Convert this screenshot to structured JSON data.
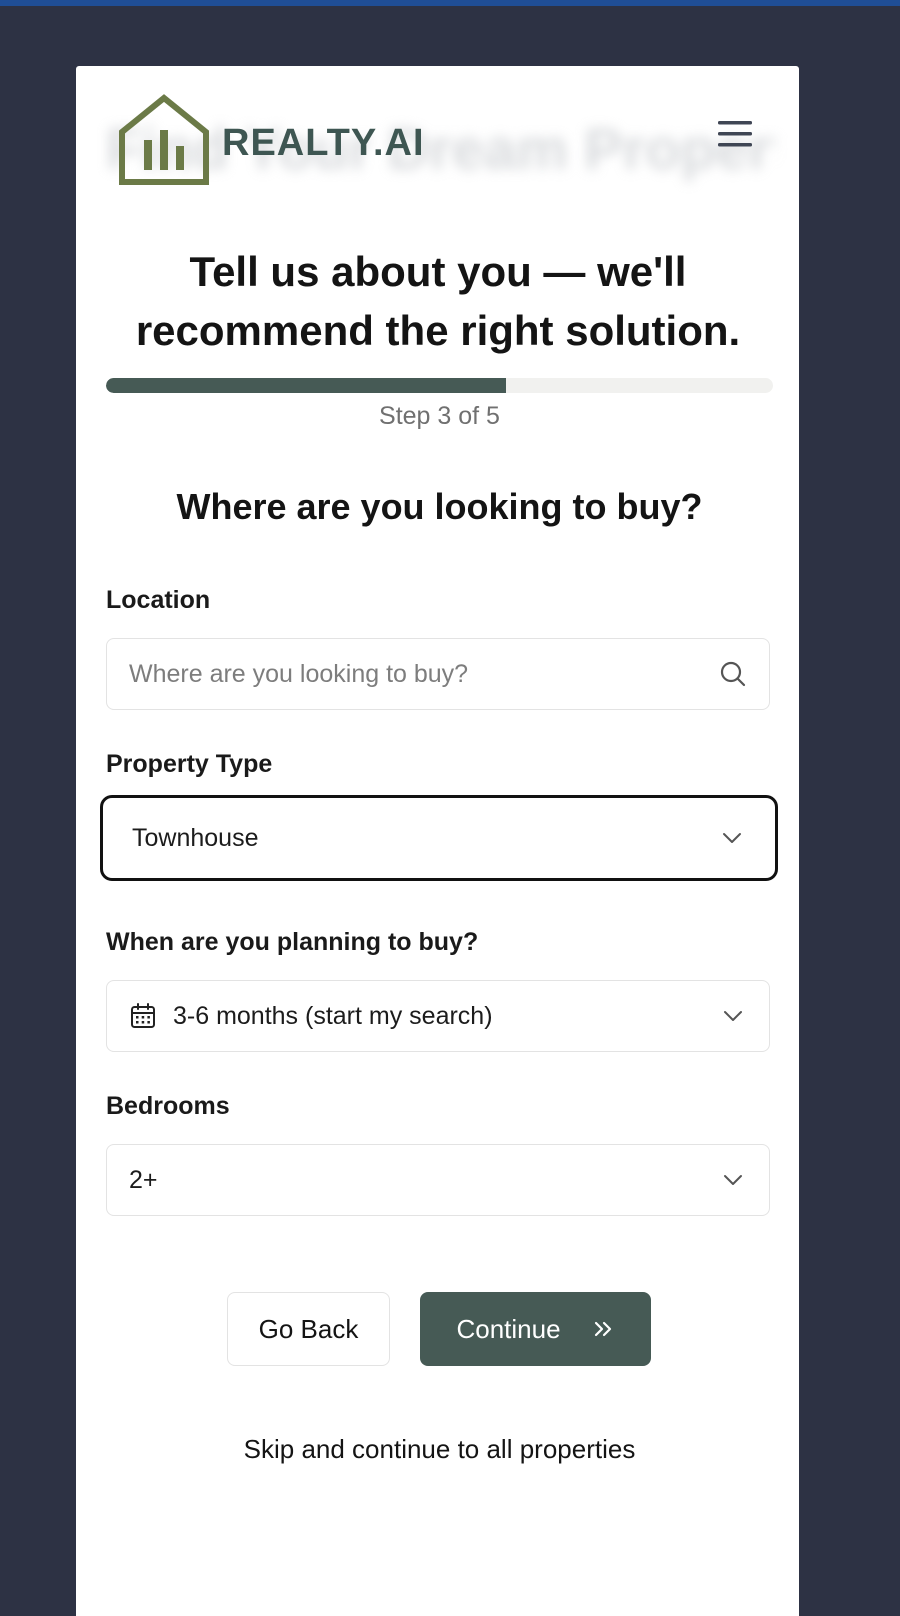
{
  "brand": {
    "name": "REALTY.AI",
    "background_title": "Find Your Dream Property",
    "logo_color": "#6b7a47",
    "text_color": "#3e5652"
  },
  "header": {
    "menu_icon": "hamburger-menu-icon"
  },
  "intro": {
    "headline": "Tell us about you — we'll recommend the right solution.",
    "progress_fraction": 0.6,
    "step_text": "Step 3 of 5"
  },
  "form": {
    "question": "Where are you looking to buy?",
    "location": {
      "label": "Location",
      "placeholder": "Where are you looking to buy?",
      "value": "",
      "icon": "search-icon"
    },
    "property_type": {
      "label": "Property Type",
      "value": "Townhouse",
      "icon": "chevron-down-icon"
    },
    "timeline": {
      "label": "When are you planning to buy?",
      "value": "3-6 months (start my search)",
      "icon": "calendar-icon"
    },
    "bedrooms": {
      "label": "Bedrooms",
      "value": "2+"
    }
  },
  "actions": {
    "back_label": "Go Back",
    "continue_label": "Continue",
    "skip_label": "Skip and continue to all properties"
  },
  "colors": {
    "page_background": "#2d3244",
    "accent": "#465a55",
    "top_bar": "#1f4e96"
  }
}
